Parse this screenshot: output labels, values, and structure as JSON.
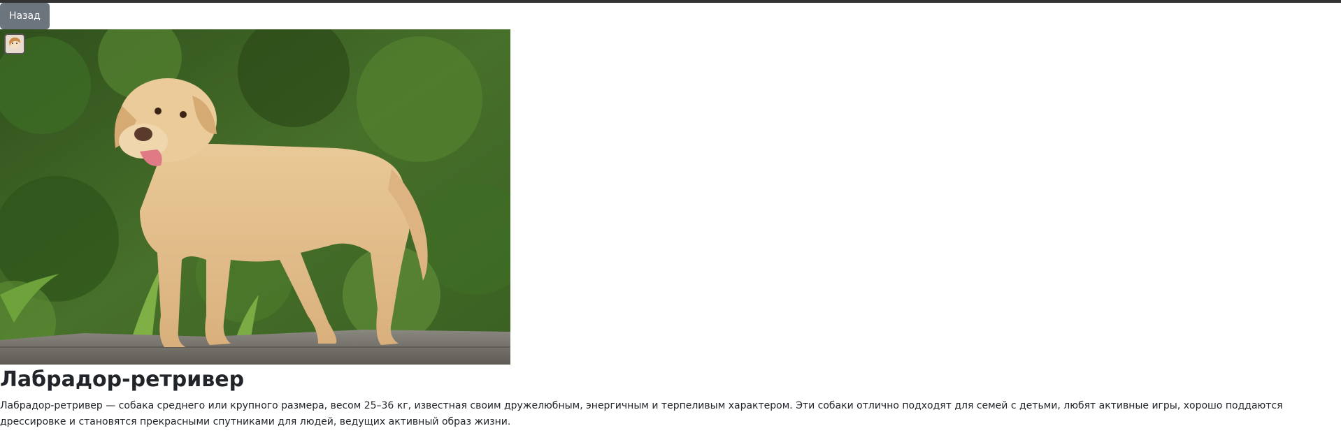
{
  "toolbar": {
    "back_label": "Назад"
  },
  "breed": {
    "name": "Лабрадор-ретривер",
    "description": "Лабрадор-ретривер — собака среднего или крупного размера, весом 25–36 кг, известная своим дружелюбным, энергичным и терпеливым характером. Эти собаки отлично подходят для семей с детьми, любят активные игры, хорошо поддаются дрессировке и становятся прекрасными спутниками для людей, ведущих активный образ жизни."
  },
  "colors": {
    "top_border": "#333333",
    "back_button_bg": "#6c757d",
    "back_button_text": "#ffffff",
    "text": "#212529"
  },
  "icons": {
    "avatar": "user-avatar-icon"
  }
}
